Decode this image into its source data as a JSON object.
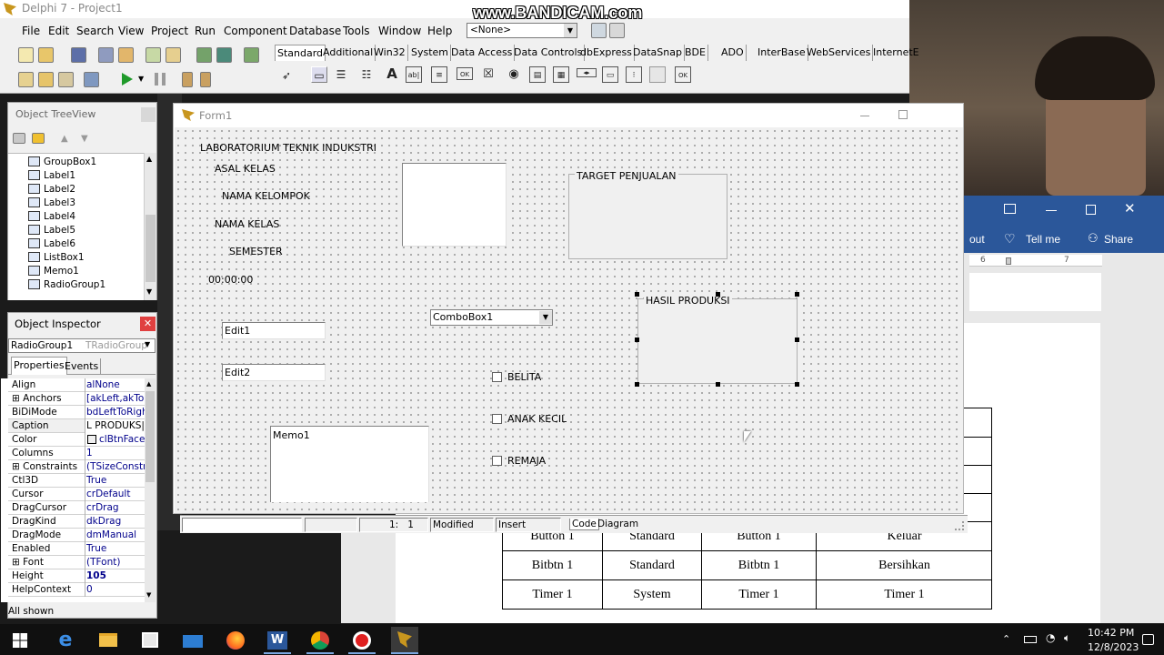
{
  "ide": {
    "title": "Delphi 7 - Project1",
    "menu": [
      "File",
      "Edit",
      "Search",
      "View",
      "Project",
      "Run",
      "Component",
      "Database",
      "Tools",
      "Window",
      "Help"
    ],
    "desktop_combo": "<None>",
    "palette_tabs": [
      "Standard",
      "Additional",
      "Win32",
      "System",
      "Data Access",
      "Data Controls",
      "dbExpress",
      "DataSnap",
      "BDE",
      "ADO",
      "InterBase",
      "WebServices",
      "InternetE"
    ]
  },
  "watermark": "www.BANDICAM.com",
  "tree_view": {
    "title": "Object TreeView",
    "items": [
      "GroupBox1",
      "Label1",
      "Label2",
      "Label3",
      "Label4",
      "Label5",
      "Label6",
      "ListBox1",
      "Memo1",
      "RadioGroup1"
    ]
  },
  "inspector": {
    "title": "Object Inspector",
    "selected_object": "RadioGroup1",
    "selected_type": "TRadioGroup",
    "tabs": [
      "Properties",
      "Events"
    ],
    "rows": [
      {
        "k": "Align",
        "v": "alNone"
      },
      {
        "k": "Anchors",
        "v": "[akLeft,akTop"
      },
      {
        "k": "BiDiMode",
        "v": "bdLeftToRight"
      },
      {
        "k": "Caption",
        "v": "L PRODUKS|"
      },
      {
        "k": "Color",
        "v": "clBtnFace"
      },
      {
        "k": "Columns",
        "v": "1"
      },
      {
        "k": "Constraints",
        "v": "(TSizeConstra"
      },
      {
        "k": "Ctl3D",
        "v": "True"
      },
      {
        "k": "Cursor",
        "v": "crDefault"
      },
      {
        "k": "DragCursor",
        "v": "crDrag"
      },
      {
        "k": "DragKind",
        "v": "dkDrag"
      },
      {
        "k": "DragMode",
        "v": "dmManual"
      },
      {
        "k": "Enabled",
        "v": "True"
      },
      {
        "k": "Font",
        "v": "(TFont)"
      },
      {
        "k": "Height",
        "v": "105"
      },
      {
        "k": "HelpContext",
        "v": "0"
      }
    ],
    "footer": "All shown"
  },
  "form": {
    "title": "Form1",
    "labels": {
      "lab": "LABORATORIUM TEKNIK INDUKSTRI",
      "asal": "ASAL KELAS",
      "kelompok": "NAMA KELOMPOK",
      "nama_kelas": "NAMA KELAS",
      "semester": "SEMESTER",
      "time": "00:00:00"
    },
    "edit1": "Edit1",
    "edit2": "Edit2",
    "memo": "Memo1",
    "combobox": "ComboBox1",
    "groupbox": "TARGET PENJUALAN",
    "radiogroup": "HASIL PRODUKSI",
    "checkboxes": [
      "BELITA",
      "ANAK KECIL",
      "REMAJA"
    ]
  },
  "editor_status": {
    "position": "1:   1",
    "modified": "Modified",
    "mode": "Insert",
    "tabs": [
      "Code",
      "Diagram"
    ]
  },
  "word": {
    "tell_me": "Tell me",
    "share": "Share",
    "out": "out",
    "ruler_marks": [
      "6",
      "7"
    ],
    "table": [
      [
        "Button 1",
        "Standard",
        "Button 1",
        "Keluar"
      ],
      [
        "Bitbtn 1",
        "Standard",
        "Bitbtn 1",
        "Bersihkan"
      ],
      [
        "Timer 1",
        "System",
        "Timer 1",
        "Timer 1"
      ]
    ]
  },
  "taskbar": {
    "time": "10:42 PM",
    "date": "12/8/2023"
  }
}
